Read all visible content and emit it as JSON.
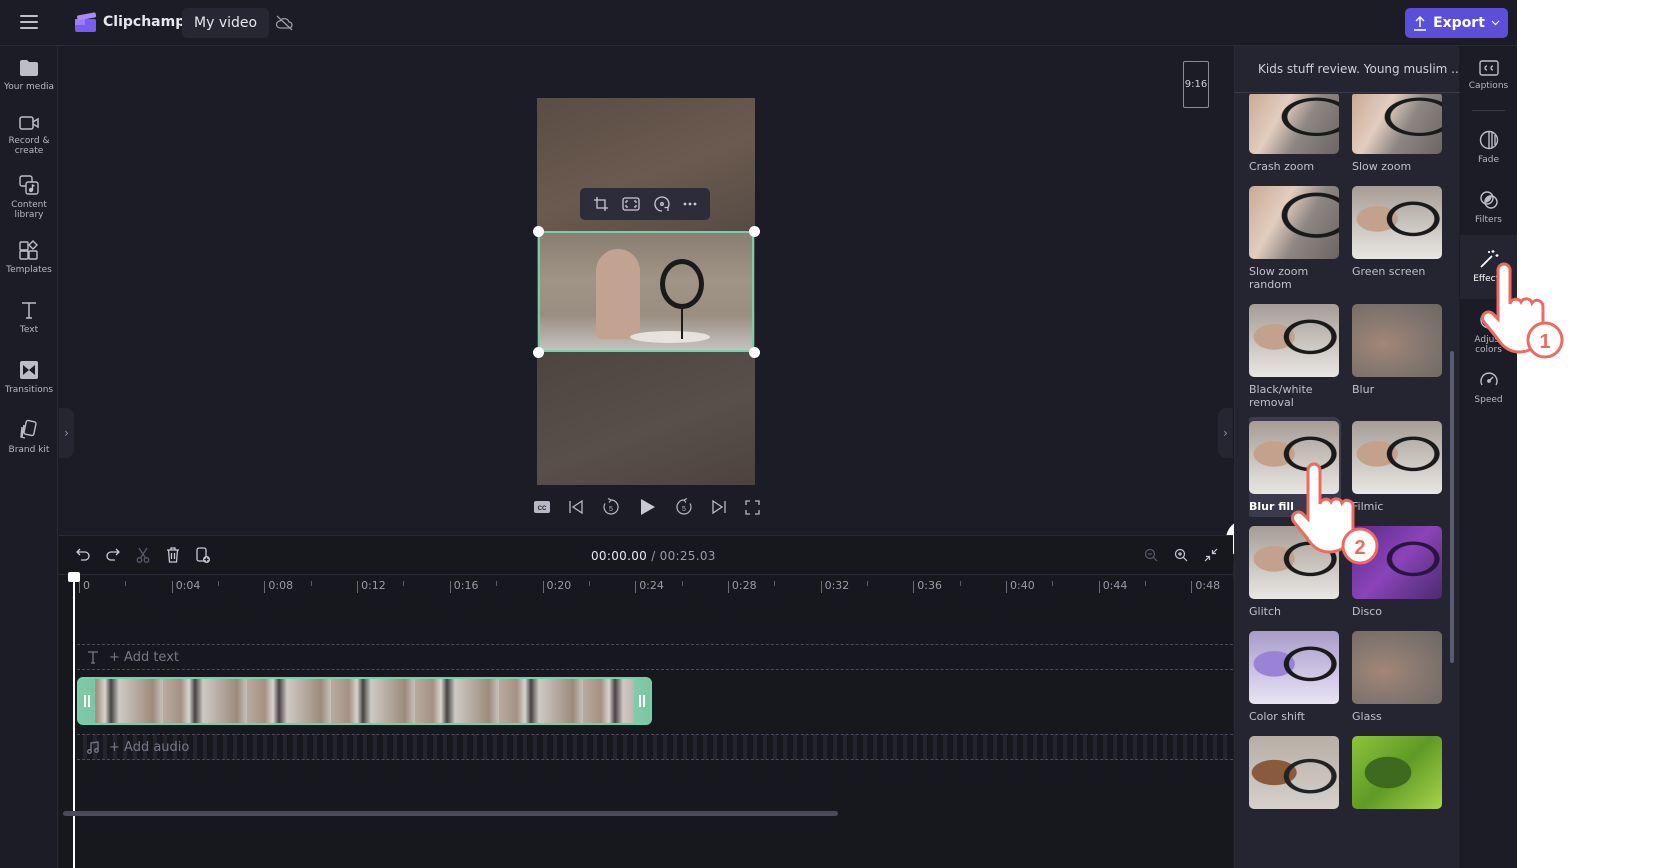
{
  "app": {
    "name": "Clipchamp",
    "project_title": "My video",
    "export_label": "Export"
  },
  "left_nav": [
    {
      "label1": "Your media",
      "label2": "",
      "icon": "folder-icon"
    },
    {
      "label1": "Record &",
      "label2": "create",
      "icon": "camera-icon"
    },
    {
      "label1": "Content",
      "label2": "library",
      "icon": "content-library-icon"
    },
    {
      "label1": "Templates",
      "label2": "",
      "icon": "templates-icon"
    },
    {
      "label1": "Text",
      "label2": "",
      "icon": "text-icon"
    },
    {
      "label1": "Transitions",
      "label2": "",
      "icon": "transitions-icon"
    },
    {
      "label1": "Brand kit",
      "label2": "",
      "icon": "brand-kit-icon"
    }
  ],
  "stage": {
    "aspect_ratio": "9:16",
    "help_label": "?"
  },
  "timeline": {
    "current_time": "00:00.00",
    "separator": " / ",
    "total_time": "00:25.03",
    "ruler_labels": [
      "0",
      "0:04",
      "0:08",
      "0:12",
      "0:16",
      "0:20",
      "0:24",
      "0:28",
      "0:32",
      "0:36",
      "0:40",
      "0:44",
      "0:48"
    ],
    "add_text": "+ Add text",
    "add_audio": "+ Add audio"
  },
  "panel": {
    "clip_name": "Kids stuff review. Young muslim ...",
    "effects": [
      {
        "label": "Crash zoom",
        "style": "zoomed"
      },
      {
        "label": "Slow zoom",
        "style": "zoomed"
      },
      {
        "label": "Slow zoom random",
        "style": "zoomed"
      },
      {
        "label": "Green screen",
        "style": "normal"
      },
      {
        "label": "Black/white removal",
        "style": "normal"
      },
      {
        "label": "Blur",
        "style": "blur"
      },
      {
        "label": "Blur fill",
        "style": "normal",
        "selected": true
      },
      {
        "label": "Filmic",
        "style": "normal"
      },
      {
        "label": "Glitch",
        "style": "normal"
      },
      {
        "label": "Disco",
        "style": "purple"
      },
      {
        "label": "Color shift",
        "style": "lavender"
      },
      {
        "label": "Glass",
        "style": "blur"
      },
      {
        "label": "",
        "style": "sketch"
      },
      {
        "label": "",
        "style": "green"
      }
    ]
  },
  "right_rail": [
    {
      "label1": "Captions",
      "label2": "",
      "icon": "captions-icon"
    },
    {
      "label1": "Fade",
      "label2": "",
      "icon": "fade-icon"
    },
    {
      "label1": "Filters",
      "label2": "",
      "icon": "filters-icon"
    },
    {
      "label1": "Effects",
      "label2": "",
      "icon": "magic-wand-icon",
      "active": true
    },
    {
      "label1": "Adjust",
      "label2": "colors",
      "icon": "adjust-colors-icon"
    },
    {
      "label1": "Speed",
      "label2": "",
      "icon": "speed-icon"
    }
  ],
  "annotations": {
    "step1": "1",
    "step2": "2",
    "accent": "#f0695f"
  },
  "colors": {
    "export": "#5b4fd9",
    "selection": "#72d1a9",
    "background": "#1c1c26"
  }
}
